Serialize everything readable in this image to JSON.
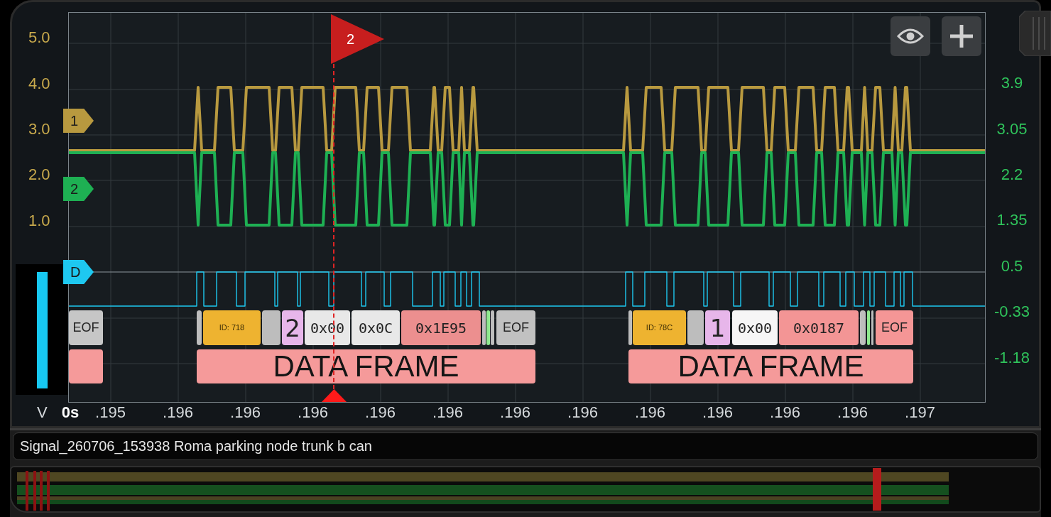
{
  "plot": {
    "left_axis": {
      "unit": "V",
      "ticks": [
        "5.0",
        "4.0",
        "3.0",
        "2.0",
        "1.0"
      ]
    },
    "right_axis": {
      "ticks": [
        "3.9",
        "3.05",
        "2.2",
        "1.35",
        "0.5",
        "-0.33",
        "-1.18"
      ]
    },
    "time_axis": {
      "origin": "0s",
      "ticks": [
        ".195",
        ".196",
        ".196",
        ".196",
        ".196",
        ".196",
        ".196",
        ".196",
        ".196",
        ".196",
        ".196",
        ".196",
        ".197"
      ]
    },
    "channels": [
      {
        "label": "1",
        "color": "#b8993f"
      },
      {
        "label": "2",
        "color": "#1eb053"
      },
      {
        "label": "D",
        "color": "#1ec8f0"
      }
    ],
    "cursor": {
      "label": "2"
    },
    "decoded_fields": [
      {
        "kind": "eof",
        "text": "EOF",
        "color": "#c6c6c6"
      },
      {
        "kind": "sof",
        "color": "#bdbdbd"
      },
      {
        "kind": "id",
        "text": "ID: 718",
        "color": "#eeb330"
      },
      {
        "kind": "control",
        "color": "#bdbdbd"
      },
      {
        "kind": "dlc",
        "text": "2",
        "color": "#e7b6ea"
      },
      {
        "kind": "data",
        "text": "0x00",
        "color": "#e8e8e8"
      },
      {
        "kind": "data",
        "text": "0x0C",
        "color": "#e8e8e8"
      },
      {
        "kind": "crc",
        "text": "0x1E95",
        "color": "#ec8f8f"
      },
      {
        "kind": "delimiter",
        "color": "#bdbdbd"
      },
      {
        "kind": "ack",
        "color": "#8fe88f"
      },
      {
        "kind": "delimiter",
        "color": "#bdbdbd"
      },
      {
        "kind": "eof",
        "text": "EOF",
        "color": "#c1c1c1"
      },
      {
        "kind": "sof",
        "color": "#bdbdbd"
      },
      {
        "kind": "id",
        "text": "ID: 78C",
        "color": "#eeb330"
      },
      {
        "kind": "control",
        "color": "#bdbdbd"
      },
      {
        "kind": "dlc",
        "text": "1",
        "color": "#e7b6ea"
      },
      {
        "kind": "data",
        "text": "0x00",
        "color": "#f6f6f6"
      },
      {
        "kind": "crc",
        "text": "0x0187",
        "color": "#f39595"
      },
      {
        "kind": "delimiter",
        "color": "#bdbdbd"
      },
      {
        "kind": "ack",
        "color": "#8fe88f"
      },
      {
        "kind": "delimiter",
        "color": "#bdbdbd"
      },
      {
        "kind": "eof",
        "text": "EOF",
        "color": "#f59696"
      }
    ],
    "frames": [
      {
        "kind": "partial"
      },
      {
        "kind": "frame",
        "label": "DATA FRAME"
      },
      {
        "kind": "frame",
        "label": "DATA FRAME"
      }
    ]
  },
  "signal_name": "Signal_260706_153938 Roma parking node trunk b can"
}
